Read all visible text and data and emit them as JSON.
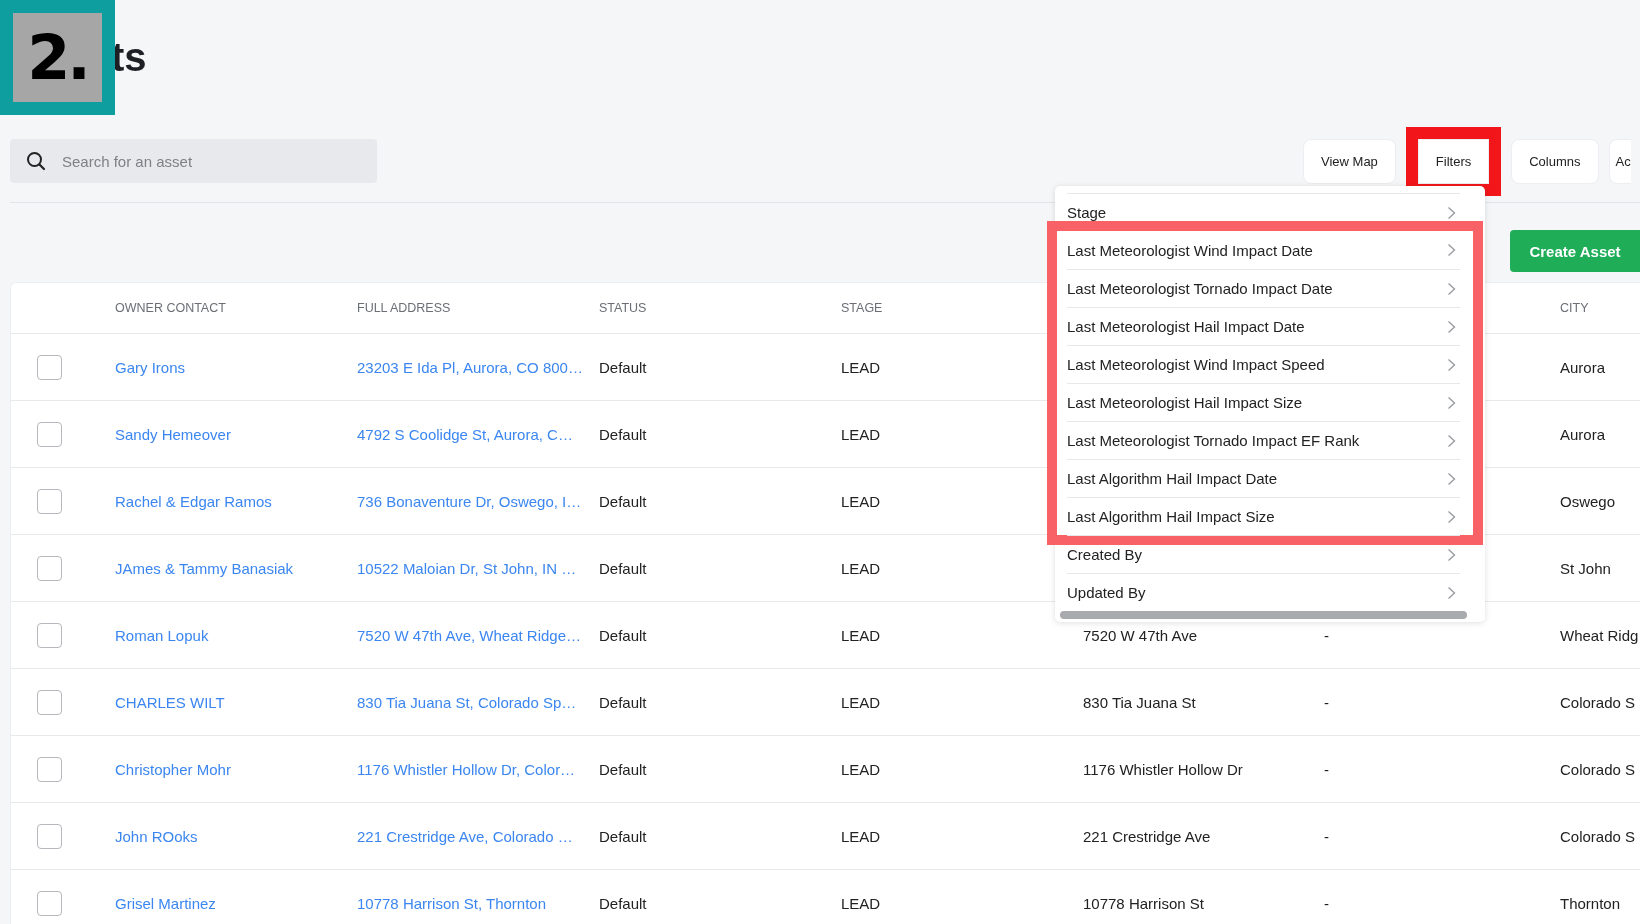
{
  "step_badge": "2.",
  "title": "ts",
  "search": {
    "placeholder": "Search for an asset"
  },
  "toolbar_buttons": [
    {
      "label": "View Map",
      "highlighted": false
    },
    {
      "label": "Filters",
      "highlighted": true
    },
    {
      "label": "Columns",
      "highlighted": false
    },
    {
      "label": "Ac",
      "highlighted": false
    }
  ],
  "create_button": "Create Asset",
  "table": {
    "columns": [
      "",
      "OWNER CONTACT",
      "FULL ADDRESS",
      "STATUS",
      "STAGE",
      "",
      "",
      "CITY"
    ],
    "rows": [
      {
        "checked": false,
        "owner": "Gary Irons",
        "address": "23203 E Ida Pl, Aurora, CO 800…",
        "status": "Default",
        "stage": "LEAD",
        "city": "Aurora"
      },
      {
        "checked": false,
        "owner": "Sandy Hemeover",
        "address": "4792 S Coolidge St, Aurora, C…",
        "status": "Default",
        "stage": "LEAD",
        "city": "Aurora"
      },
      {
        "checked": false,
        "owner": "Rachel & Edgar Ramos",
        "address": "736 Bonaventure Dr, Oswego, I…",
        "status": "Default",
        "stage": "LEAD",
        "city": "Oswego"
      },
      {
        "checked": false,
        "owner": "JAmes & Tammy Banasiak",
        "address": "10522 Maloian Dr, St John, IN …",
        "status": "Default",
        "stage": "LEAD",
        "city": "St John"
      },
      {
        "checked": false,
        "owner": "Roman Lopuk",
        "address": "7520 W 47th Ave, Wheat Ridge…",
        "status": "Default",
        "stage": "LEAD",
        "column_5": "7520 W 47th Ave",
        "column_6": "-",
        "city": "Wheat Ridg"
      },
      {
        "checked": false,
        "owner": "CHARLES WILT",
        "address": "830 Tia Juana St, Colorado Sp…",
        "status": "Default",
        "stage": "LEAD",
        "column_5": "830 Tia Juana St",
        "column_6": "-",
        "city": "Colorado S"
      },
      {
        "checked": false,
        "owner": "Christopher Mohr",
        "address": "1176 Whistler Hollow Dr, Color…",
        "status": "Default",
        "stage": "LEAD",
        "column_5": "1176 Whistler Hollow Dr",
        "column_6": "-",
        "city": "Colorado S"
      },
      {
        "checked": false,
        "owner": "John ROoks",
        "address": "221 Crestridge Ave, Colorado …",
        "status": "Default",
        "stage": "LEAD",
        "column_5": "221 Crestridge Ave",
        "column_6": "-",
        "city": "Colorado S"
      },
      {
        "checked": false,
        "owner": "Grisel Martinez",
        "address": "10778 Harrison St, Thornton",
        "status": "Default",
        "stage": "LEAD",
        "column_5": "10778 Harrison St",
        "column_6": "-",
        "city": "Thornton"
      }
    ]
  },
  "filter_menu": {
    "items": [
      {
        "label": "Stage",
        "highlighted": false
      },
      {
        "label": "Last Meteorologist Wind Impact Date",
        "highlighted": true
      },
      {
        "label": "Last Meteorologist Tornado Impact Date",
        "highlighted": true
      },
      {
        "label": "Last Meteorologist Hail Impact Date",
        "highlighted": true
      },
      {
        "label": "Last Meteorologist Wind Impact Speed",
        "highlighted": true
      },
      {
        "label": "Last Meteorologist Hail Impact Size",
        "highlighted": true
      },
      {
        "label": "Last Meteorologist Tornado Impact EF Rank",
        "highlighted": true
      },
      {
        "label": "Last Algorithm Hail Impact Date",
        "highlighted": true
      },
      {
        "label": "Last Algorithm Hail Impact Size",
        "highlighted": true
      },
      {
        "label": "Created By",
        "highlighted": false
      },
      {
        "label": "Updated By",
        "highlighted": false
      }
    ]
  }
}
